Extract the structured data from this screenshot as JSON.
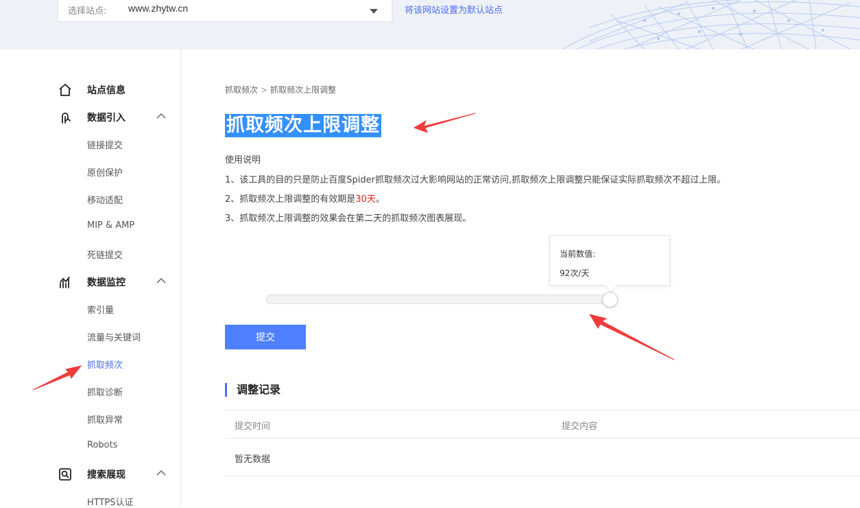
{
  "header": {
    "site_label": "选择站点:",
    "site_value": "www.zhytw.cn",
    "set_default": "将该网站设置为默认站点"
  },
  "sidebar": {
    "groups": [
      {
        "label": "站点信息",
        "icon": "home-icon"
      },
      {
        "label": "数据引入",
        "icon": "data-import-icon"
      },
      {
        "label": "数据监控",
        "icon": "chart-icon"
      },
      {
        "label": "搜索展现",
        "icon": "search-display-icon"
      }
    ],
    "items": [
      {
        "label": "链接提交"
      },
      {
        "label": "原创保护"
      },
      {
        "label": "移动适配"
      },
      {
        "label": "MIP & AMP"
      },
      {
        "label": "死链提交"
      },
      {
        "label": "索引量"
      },
      {
        "label": "流量与关键词"
      },
      {
        "label": "抓取频次",
        "active": true
      },
      {
        "label": "抓取诊断"
      },
      {
        "label": "抓取异常"
      },
      {
        "label": "Robots"
      },
      {
        "label": "HTTPS认证"
      }
    ]
  },
  "main": {
    "breadcrumb": [
      "抓取频次",
      "抓取频次上限调整"
    ],
    "breadcrumb_sep": ">",
    "title": "抓取频次上限调整",
    "usage_title": "使用说明",
    "usage_1": "1、该工具的目的只是防止百度Spider抓取频次过大影响网站的正常访问,抓取频次上限调整只能保证实际抓取频次不超过上限。",
    "usage_2_pre": "2、抓取频次上限调整的有效期是",
    "usage_2_red": "30天",
    "usage_2_post": "。",
    "usage_3": "3、抓取频次上限调整的效果会在第二天的抓取频次图表展现。",
    "slider": {
      "tooltip_label": "当前数值:",
      "tooltip_value": "92次/天",
      "level": 1.0
    },
    "submit": "提交",
    "records": {
      "title": "调整记录",
      "col_time": "提交时间",
      "col_content": "提交内容",
      "empty": "暂无数据"
    }
  },
  "colors": {
    "accent": "#4e6ef2",
    "button": "#4e80ff",
    "title_highlight": "#3390ff",
    "annotation_arrow": "#f03c3c"
  }
}
